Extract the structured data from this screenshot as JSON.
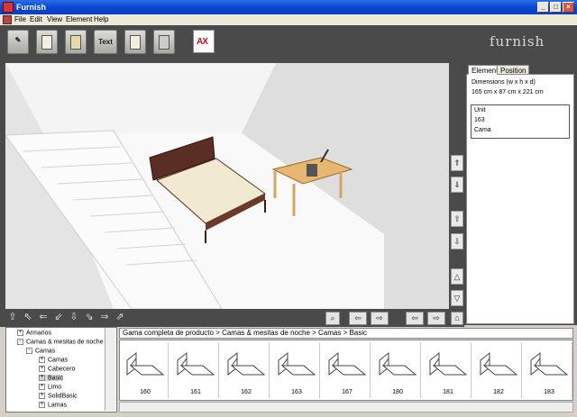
{
  "window": {
    "title": "Furnish"
  },
  "menu": [
    "File",
    "Edit",
    "View",
    "Element",
    "Help"
  ],
  "toolbar": {
    "text_label": "Text",
    "ax_label": "AX"
  },
  "brand": {
    "logo": "furnish"
  },
  "properties": {
    "tabs": [
      "Element",
      "Position"
    ],
    "dimensions_label": "Dimensions (w x h x d)",
    "dimensions_value": "165 cm x 87 cm x 221 cm",
    "info": [
      "Unit",
      "163",
      "Cama"
    ]
  },
  "tree": [
    {
      "label": "Armarios",
      "expander": "+"
    },
    {
      "label": "Camas & mesitas de noche",
      "expander": "-"
    },
    {
      "label": "Camas",
      "expander": "-"
    },
    {
      "label": "Camas",
      "expander": "+"
    },
    {
      "label": "Cabecero",
      "expander": "+"
    },
    {
      "label": "Basic",
      "expander": "+"
    },
    {
      "label": "Limo",
      "expander": "+"
    },
    {
      "label": "SolidBasic",
      "expander": "+"
    },
    {
      "label": "Lamas",
      "expander": "+"
    }
  ],
  "breadcrumb": "Gama completa de producto > Camas & mesitas de noche > Camas > Basic",
  "products": [
    "160",
    "161",
    "162",
    "163",
    "167",
    "180",
    "181",
    "182",
    "183"
  ],
  "colors": {
    "chrome": "#4a4a4a",
    "titlebar": "#0a47d4",
    "accent_red": "#cc1111"
  }
}
